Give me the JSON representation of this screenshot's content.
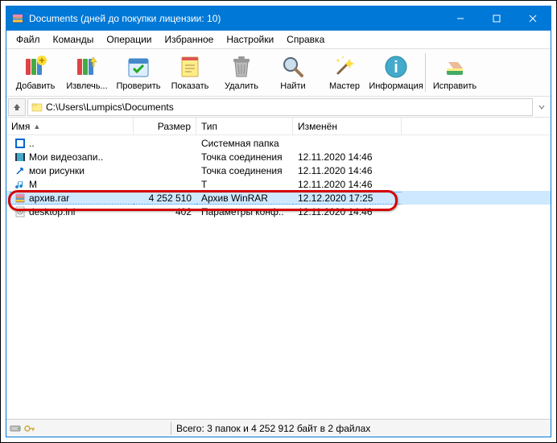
{
  "titlebar": {
    "title": "Documents (дней до покупки лицензии: 10)"
  },
  "menu": {
    "file": "Файл",
    "commands": "Команды",
    "operations": "Операции",
    "favorites": "Избранное",
    "settings": "Настройки",
    "help": "Справка"
  },
  "toolbar": {
    "add": "Добавить",
    "extract": "Извлечь...",
    "test": "Проверить",
    "view": "Показать",
    "delete": "Удалить",
    "find": "Найти",
    "wizard": "Мастер",
    "info": "Информация",
    "repair": "Исправить"
  },
  "address": {
    "path": "C:\\Users\\Lumpics\\Documents"
  },
  "columns": {
    "name": "Имя",
    "size": "Размер",
    "type": "Тип",
    "modified": "Изменён"
  },
  "rows": [
    {
      "name": "..",
      "size": "",
      "type": "Системная папка",
      "modified": "",
      "icon": "up"
    },
    {
      "name": "Мои видеозапи..",
      "size": "",
      "type": "Точка соединения",
      "modified": "12.11.2020 14:46",
      "icon": "video"
    },
    {
      "name": "мои рисунки",
      "size": "",
      "type": "Точка соединения",
      "modified": "12.11.2020 14:46",
      "icon": "shortcut"
    },
    {
      "name": "М",
      "size": "",
      "type": "Т",
      "modified": "12.11.2020 14:46",
      "icon": "music"
    },
    {
      "name": "архив.rar",
      "size": "4 252 510",
      "type": "Архив WinRAR",
      "modified": "12.12.2020 17:25",
      "icon": "rar",
      "selected": true
    },
    {
      "name": "desktop.ini",
      "size": "402",
      "type": "Параметры конф..",
      "modified": "12.11.2020 14:46",
      "icon": "ini"
    }
  ],
  "status": {
    "total": "Всего: 3 папок и 4 252 912 байт в 2 файлах"
  }
}
